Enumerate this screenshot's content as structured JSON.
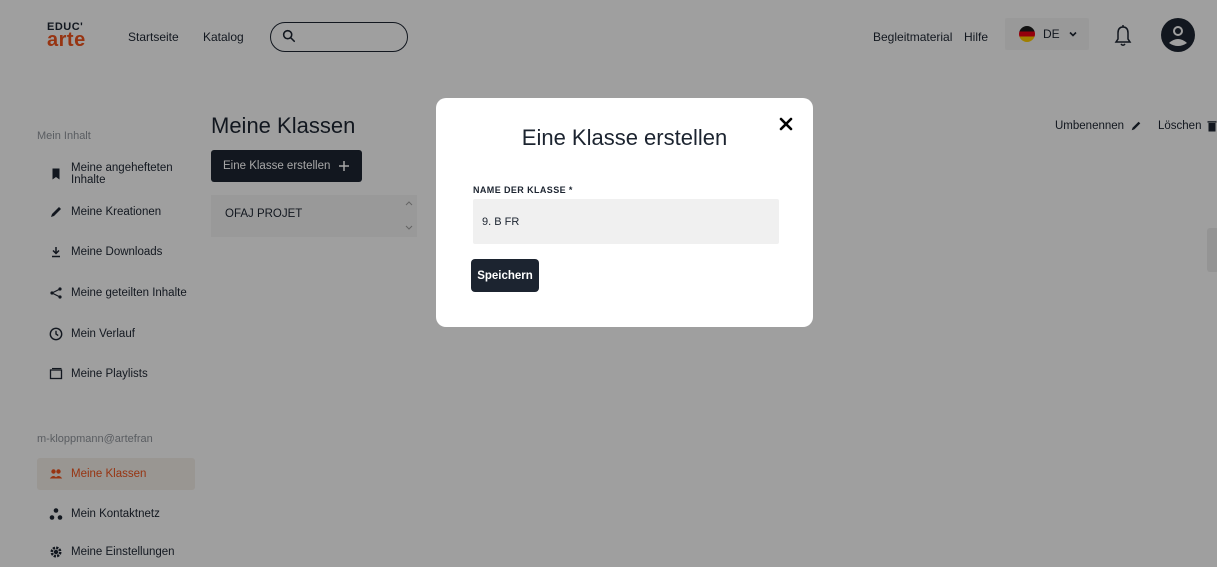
{
  "header": {
    "logo_top": "EDUC'",
    "logo_bottom": "arte",
    "nav_home": "Startseite",
    "nav_catalog": "Katalog",
    "search_placeholder": "",
    "nav_materials": "Begleitmaterial",
    "nav_help": "Hilfe",
    "language": "DE"
  },
  "sidebar": {
    "section1_heading": "Mein Inhalt",
    "items": [
      {
        "label": "Meine angehefteten Inhalte",
        "icon": "bookmark-icon"
      },
      {
        "label": "Meine Kreationen",
        "icon": "pencil-icon"
      },
      {
        "label": "Meine Downloads",
        "icon": "download-icon"
      },
      {
        "label": "Meine geteilten Inhalte",
        "icon": "share-icon"
      },
      {
        "label": "Mein Verlauf",
        "icon": "clock-icon"
      },
      {
        "label": "Meine Playlists",
        "icon": "playlist-icon"
      }
    ],
    "section2_heading": "m-kloppmann@artefran",
    "items2": [
      {
        "label": "Meine Klassen",
        "icon": "users-icon",
        "active": true
      },
      {
        "label": "Mein Kontaktnetz",
        "icon": "network-icon"
      },
      {
        "label": "Meine Einstellungen",
        "icon": "gear-icon"
      }
    ]
  },
  "main": {
    "title": "Meine Klassen",
    "create_label": "Eine Klasse erstellen",
    "classes": [
      "OFAJ PROJET"
    ],
    "rename_label": "Umbenennen",
    "delete_label": "Löschen"
  },
  "modal": {
    "title": "Eine Klasse erstellen",
    "field_label": "NAME DER KLASSE *",
    "field_value": "9. B FR",
    "save_label": "Speichern"
  },
  "colors": {
    "brand": "#e8511c",
    "dark": "#1c2430",
    "overlay": "rgba(0,0,0,0.35)"
  }
}
